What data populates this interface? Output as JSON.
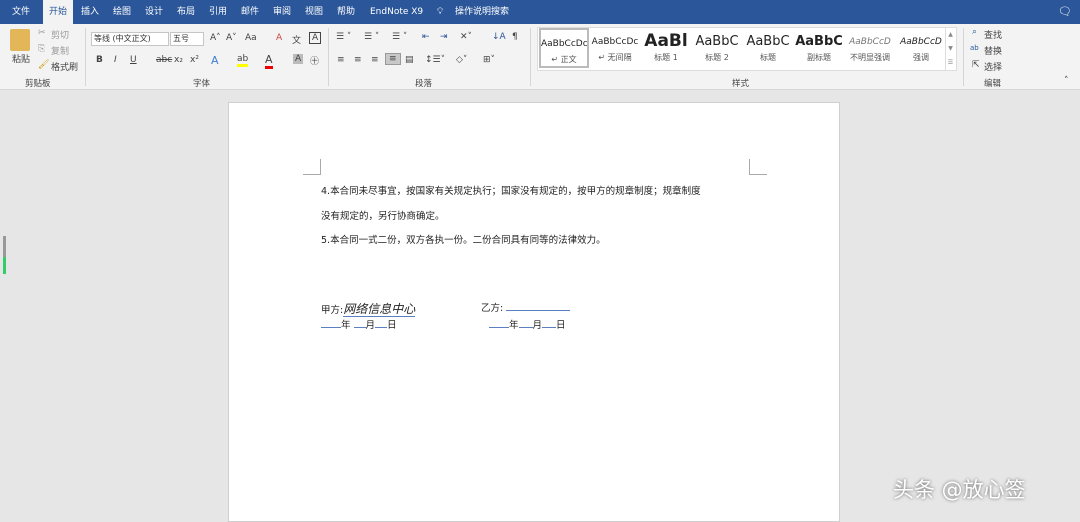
{
  "tabs": [
    "文件",
    "开始",
    "插入",
    "绘图",
    "设计",
    "布局",
    "引用",
    "邮件",
    "审阅",
    "视图",
    "帮助",
    "EndNote X9"
  ],
  "search_label": "操作说明搜索",
  "clipboard": {
    "paste": "粘贴",
    "cut": "剪切",
    "copy": "复制",
    "format_painter": "格式刷",
    "group": "剪贴板"
  },
  "font": {
    "name": "等线 (中文正文)",
    "size": "五号",
    "group": "字体",
    "case": "Aa"
  },
  "paragraph": {
    "group": "段落"
  },
  "styles": {
    "group": "样式",
    "items": [
      {
        "preview": "AaBbCcDc",
        "name": "↵ 正文"
      },
      {
        "preview": "AaBbCcDc",
        "name": "↵ 无间隔"
      },
      {
        "preview": "AaBl",
        "name": "标题 1"
      },
      {
        "preview": "AaBbC",
        "name": "标题 2"
      },
      {
        "preview": "AaBbC",
        "name": "标题"
      },
      {
        "preview": "AaBbC",
        "name": "副标题"
      },
      {
        "preview": "AaBbCcD",
        "name": "不明显强调"
      },
      {
        "preview": "AaBbCcD",
        "name": "强调"
      }
    ]
  },
  "editing": {
    "find": "查找",
    "replace": "替换",
    "select": "选择",
    "group": "编辑"
  },
  "doc": {
    "p1a": "4.本合同未尽事宜，按国家有关规定执行；国家没有规定的，按甲方的规章制度；规章制度",
    "p1b": "没有规定的，另行协商确定。",
    "p2": "5.本合同一式二份，双方各执一份。二份合同具有同等的法律效力。",
    "party_a": "甲方:",
    "signature": "网络信息中心",
    "party_b": "乙方:",
    "year": "年",
    "month": "月",
    "day": "日"
  },
  "watermark": "头条 @放心签"
}
